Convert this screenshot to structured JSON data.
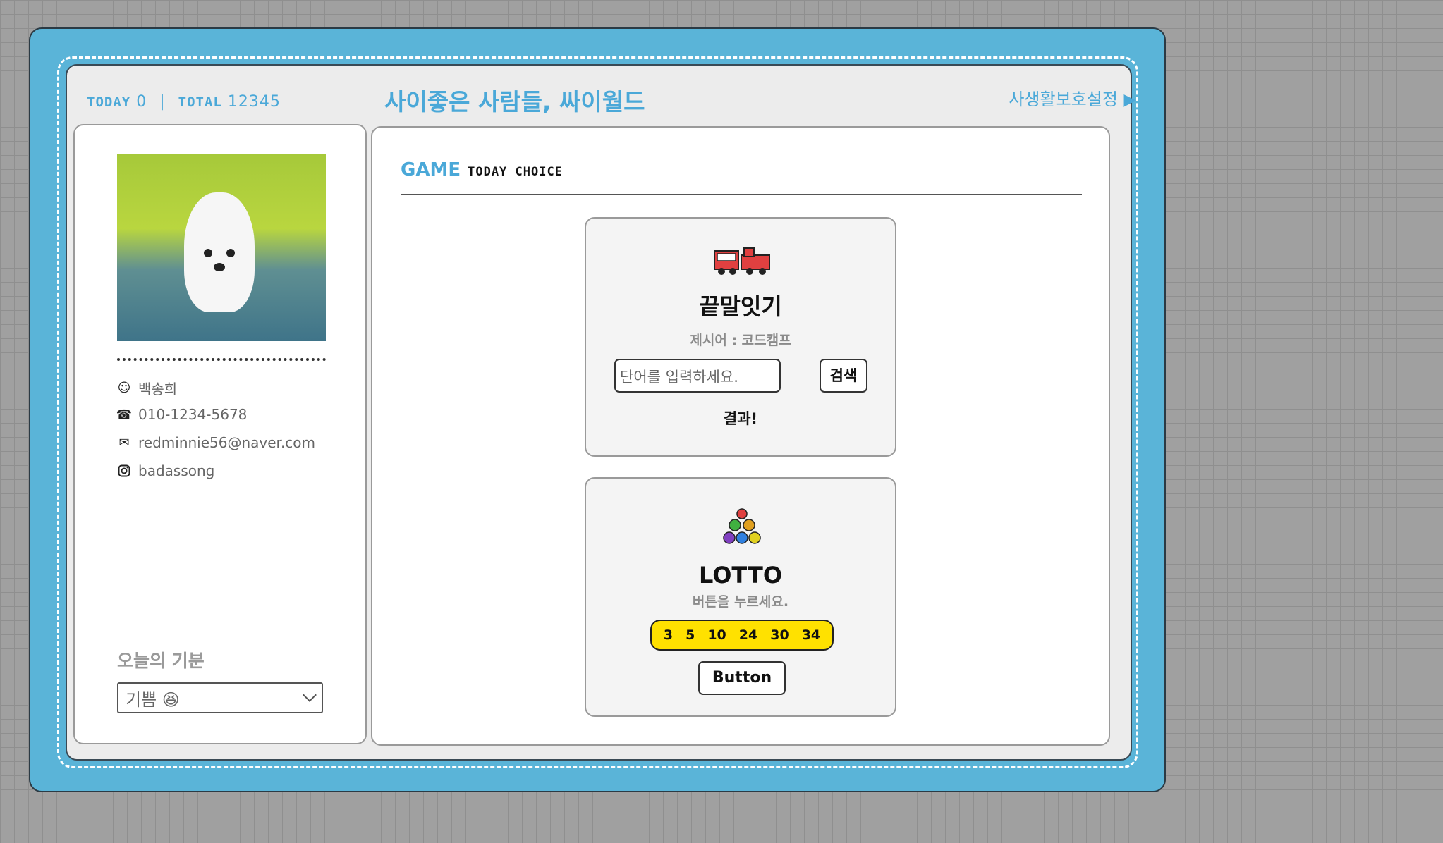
{
  "header": {
    "today_label": "Today",
    "today_value": "0",
    "separator": "|",
    "total_label": "Total",
    "total_value": "12345",
    "title": "사이좋은 사람들, 싸이월드",
    "privacy_link": "사생활보호설정 ▶"
  },
  "profile": {
    "photo_alt": "profile-dog-photo",
    "name": "백송희",
    "phone": "010-1234-5678",
    "email": "redminnie56@naver.com",
    "instagram": "badassong",
    "mood_title": "오늘의 기분",
    "mood_value": "기쁨 😆"
  },
  "game": {
    "section_title": "GAME",
    "section_sub": "Today Choice",
    "word_chain": {
      "icon": "train-icon",
      "title": "끝말잇기",
      "hint": "제시어 : 코드캠프",
      "input_placeholder": "단어를 입력하세요.",
      "search_label": "검색",
      "result_label": "결과!"
    },
    "lotto": {
      "icon": "balls-icon",
      "title": "LOTTO",
      "hint": "버튼을 누르세요.",
      "numbers": [
        "3",
        "5",
        "10",
        "24",
        "30",
        "34"
      ],
      "button_label": "Button"
    }
  },
  "colors": {
    "frame_blue": "#5ab4d8",
    "accent_blue": "#4aa8d8",
    "lotto_yellow": "#ffe100"
  }
}
